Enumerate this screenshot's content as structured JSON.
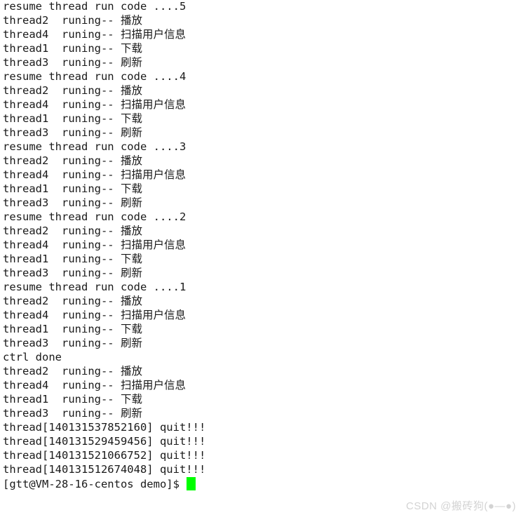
{
  "terminal": {
    "background_color": "#ffffff",
    "text_color": "#1a1a1a",
    "cursor_color": "#00ff00",
    "lines": [
      "resume thread run code ....5",
      "thread2  runing-- 播放",
      "thread4  runing-- 扫描用户信息",
      "thread1  runing-- 下载",
      "thread3  runing-- 刷新",
      "resume thread run code ....4",
      "thread2  runing-- 播放",
      "thread4  runing-- 扫描用户信息",
      "thread1  runing-- 下载",
      "thread3  runing-- 刷新",
      "resume thread run code ....3",
      "thread2  runing-- 播放",
      "thread4  runing-- 扫描用户信息",
      "thread1  runing-- 下载",
      "thread3  runing-- 刷新",
      "resume thread run code ....2",
      "thread2  runing-- 播放",
      "thread4  runing-- 扫描用户信息",
      "thread1  runing-- 下载",
      "thread3  runing-- 刷新",
      "resume thread run code ....1",
      "thread2  runing-- 播放",
      "thread4  runing-- 扫描用户信息",
      "thread1  runing-- 下载",
      "thread3  runing-- 刷新",
      "ctrl done",
      "thread2  runing-- 播放",
      "thread4  runing-- 扫描用户信息",
      "thread1  runing-- 下载",
      "thread3  runing-- 刷新",
      "thread[140131537852160] quit!!!",
      "thread[140131529459456] quit!!!",
      "thread[140131521066752] quit!!!",
      "thread[140131512674048] quit!!!"
    ],
    "prompt": "[gtt@VM-28-16-centos demo]$ "
  },
  "watermark": {
    "text": "CSDN @搬砖狗(●—●)",
    "color": "#d3d3d3"
  }
}
